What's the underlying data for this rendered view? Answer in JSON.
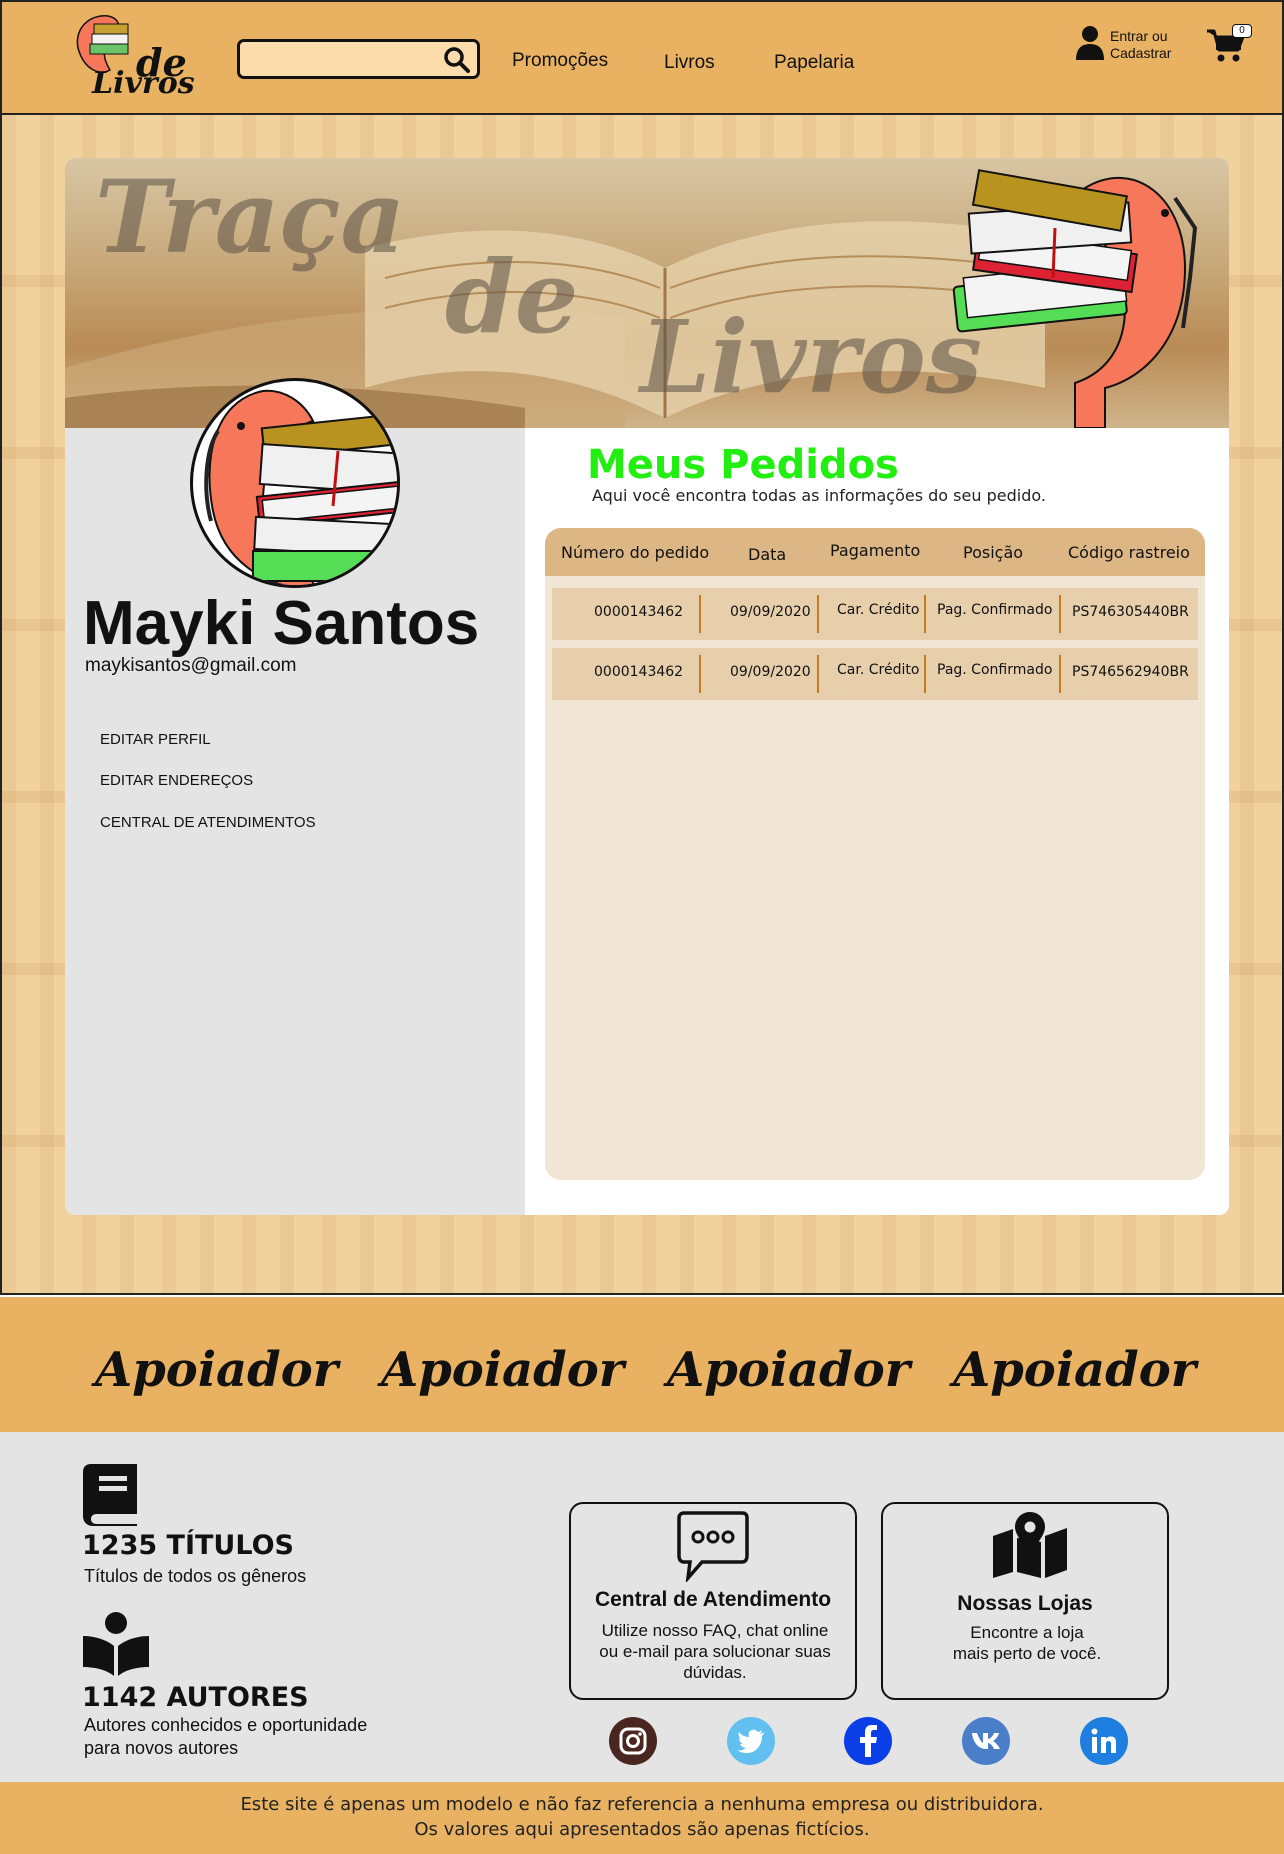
{
  "header": {
    "logo": {
      "word1": "de",
      "word2": "Livros"
    },
    "search": {
      "placeholder": "",
      "value": "",
      "icon": "search-icon"
    },
    "nav": [
      "Promoções",
      "Livros",
      "Papelaria"
    ],
    "login_label_1": "Entrar ou",
    "login_label_2": "Cadastrar",
    "cart_count": "0"
  },
  "banner": {
    "words": [
      "Traça",
      "de",
      "Livros"
    ]
  },
  "profile": {
    "name": "Mayki Santos",
    "email": "maykisantos@gmail.com",
    "links": [
      "EDITAR PERFIL",
      "EDITAR ENDEREÇOS",
      "CENTRAL DE ATENDIMENTOS"
    ]
  },
  "orders": {
    "title": "Meus Pedidos",
    "subtitle": "Aqui você encontra todas as informações do seu pedido.",
    "columns": [
      "Número do pedido",
      "Data",
      "Pagamento",
      "Posição",
      "Código rastreio"
    ],
    "rows": [
      [
        "0000143462",
        "09/09/2020",
        "Car. Crédito",
        "Pag. Confirmado",
        "PS746305440BR"
      ],
      [
        "0000143462",
        "09/09/2020",
        "Car. Crédito",
        "Pag. Confirmado",
        "PS746562940BR"
      ]
    ]
  },
  "sponsors": [
    "Apoiador",
    "Apoiador",
    "Apoiador",
    "Apoiador"
  ],
  "footer": {
    "stats": [
      {
        "number": "1235 TÍTULOS",
        "desc": "Títulos de todos os gêneros",
        "icon": "book-icon"
      },
      {
        "number": "1142 AUTORES",
        "desc_1": "Autores conhecidos e oportunidade",
        "desc_2": "para novos autores",
        "icon": "reader-icon"
      }
    ],
    "support": {
      "title": "Central de Atendimento",
      "desc_1": "Utilize nosso FAQ, chat online",
      "desc_2": "ou e-mail para solucionar suas",
      "desc_3": "dúvidas."
    },
    "stores": {
      "title": "Nossas Lojas",
      "desc_1": "Encontre a loja",
      "desc_2": "mais perto de você."
    },
    "social": [
      "instagram",
      "twitter",
      "facebook",
      "vk",
      "linkedin"
    ],
    "disclaimer_1": "Este site é apenas um modelo e não faz referencia a nenhuma empresa ou distribuidora.",
    "disclaimer_2": "Os valores aqui apresentados são apenas fictícios."
  },
  "colors": {
    "brand": "#e8b262",
    "title_green": "#22ee11",
    "mascot": "#f7775a"
  }
}
